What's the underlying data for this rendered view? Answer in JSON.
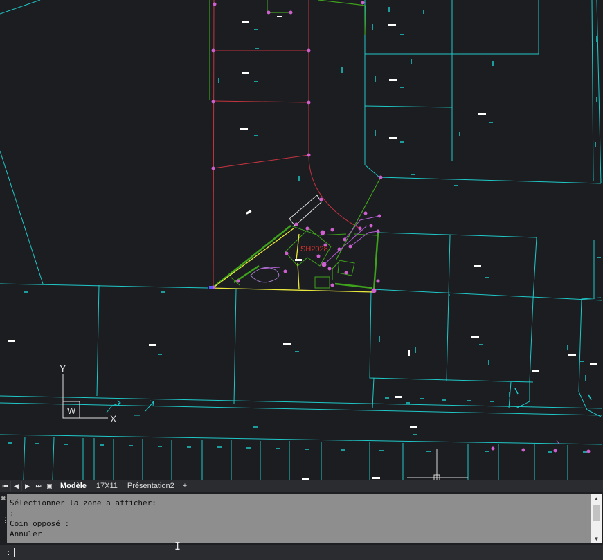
{
  "drawing": {
    "parcel_label": "SH2028",
    "ucs_axis_y": "Y",
    "ucs_axis_x": "X",
    "ucs_marker": "W",
    "colors": {
      "background": "#1c1d21",
      "parcel_lines": "#1fc8c8",
      "red_lines": "#c4343f",
      "green_lines": "#3ea21c",
      "yellow_lines": "#e6e63c",
      "magenta_points": "#d060d0",
      "text_marks": "#ffffff",
      "label": "#e0322c"
    }
  },
  "layout_tabs": {
    "nav_icons": [
      "first-tab-icon",
      "prev-tab-icon",
      "next-tab-icon",
      "last-tab-icon",
      "tab-list-icon"
    ],
    "tabs": [
      {
        "label": "Modèle",
        "active": true
      },
      {
        "label": "17X11",
        "active": false
      },
      {
        "label": "Présentation2",
        "active": false
      }
    ],
    "add_label": "+"
  },
  "command": {
    "history": [
      "Sélectionner la zone a afficher:",
      ":",
      "Coin opposé :",
      "Annuler"
    ],
    "prompt": ":",
    "input_value": ""
  }
}
